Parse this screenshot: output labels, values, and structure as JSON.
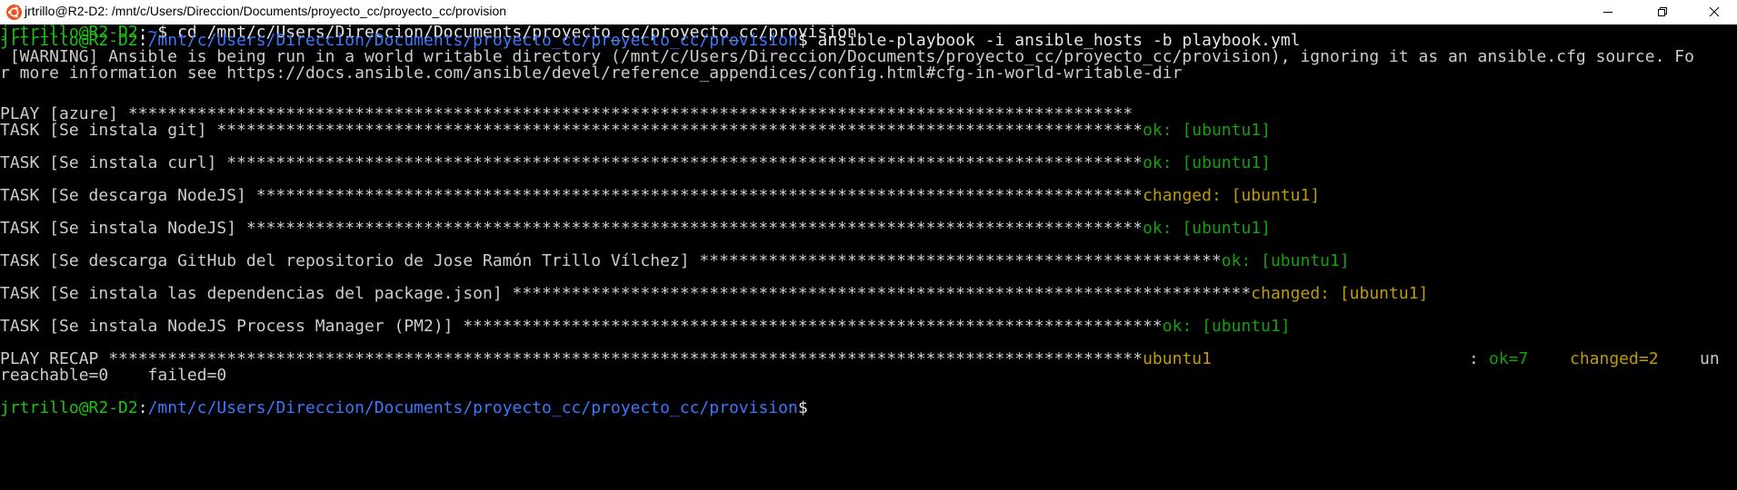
{
  "window": {
    "title": "jrtrillo@R2-D2: /mnt/c/Users/Direccion/Documents/proyecto_cc/proyecto_cc/provision",
    "icon": "ubuntu-icon",
    "controls": {
      "minimize_icon": "minimize-icon",
      "maximize_icon": "maximize-icon",
      "close_icon": "close-icon"
    }
  },
  "terminal": {
    "prompt_user": "jrtrillo@R2-D2",
    "prompt_sep": ":",
    "line1": {
      "path": "~",
      "dollar": "$",
      "cmd": " cd /mnt/c/Users/Direccion/Documents/proyecto_cc/proyecto_cc/provision"
    },
    "line2": {
      "path": "/mnt/c/Users/Direccion/Documents/proyecto_cc/proyecto_cc/provision",
      "dollar": "$",
      "cmd": " ansible-playbook -i ansible_hosts -b playbook.yml"
    },
    "warning1": " [WARNING] Ansible is being run in a world writable directory (/mnt/c/Users/Direccion/Documents/proyecto_cc/proyecto_cc/provision), ignoring it as an ansible.cfg source. Fo",
    "warning2": "r more information see https://docs.ansible.com/ansible/devel/reference_appendices/config.html#cfg-in-world-writable-dir",
    "play": "PLAY [azure] ******************************************************************************************************",
    "tasks": [
      {
        "label": "TASK [Se instala git] **********************************************************************************************",
        "result": "ok: [ubuntu1]",
        "kind": "ok"
      },
      {
        "label": "TASK [Se instala curl] *********************************************************************************************",
        "result": "ok: [ubuntu1]",
        "kind": "ok"
      },
      {
        "label": "TASK [Se descarga NodeJS] ******************************************************************************************",
        "result": "changed: [ubuntu1]",
        "kind": "changed"
      },
      {
        "label": "TASK [Se instala NodeJS] *******************************************************************************************",
        "result": "ok: [ubuntu1]",
        "kind": "ok"
      },
      {
        "label": "TASK [Se descarga GitHub del repositorio de Jose Ramón Trillo Vílchez] *****************************************************",
        "result": "ok: [ubuntu1]",
        "kind": "ok"
      },
      {
        "label": "TASK [Se instala las dependencias del package.json] ***************************************************************************",
        "result": "changed: [ubuntu1]",
        "kind": "changed"
      },
      {
        "label": "TASK [Se instala NodeJS Process Manager (PM2)] ***********************************************************************",
        "result": "ok: [ubuntu1]",
        "kind": "ok"
      }
    ],
    "recap": {
      "label": "PLAY RECAP *********************************************************************************************************",
      "host": "ubuntu1",
      "colon": ":",
      "ok": "ok=7",
      "changed": "changed=2",
      "tail": "un",
      "line2": "reachable=0    failed=0"
    },
    "final": {
      "path": "/mnt/c/Users/Direccion/Documents/proyecto_cc/proyecto_cc/provision",
      "dollar": "$"
    }
  },
  "colors": {
    "user": "#16c60c",
    "path": "#3b78ff",
    "ok": "#13a10e",
    "changed": "#c19c00",
    "text": "#cccccc",
    "background": "#000000"
  }
}
